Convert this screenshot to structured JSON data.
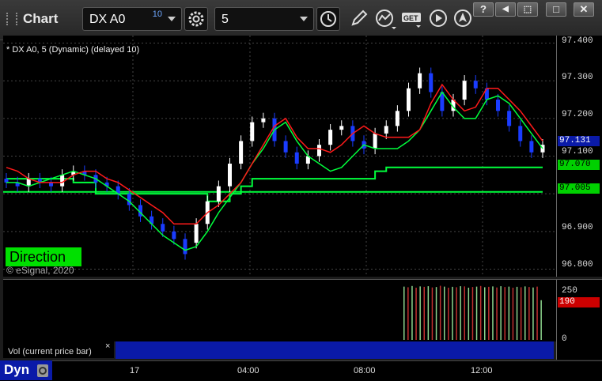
{
  "toolbar": {
    "title": "Chart",
    "symbol": "DX A0",
    "symbol_badge": "10",
    "interval": "5",
    "icons": [
      "settings-icon",
      "clock-icon",
      "pencil-icon",
      "study-icon",
      "get-icon",
      "play-icon",
      "cursor-icon"
    ]
  },
  "window_buttons": [
    "?",
    "◀",
    "⬚",
    "□",
    "✕"
  ],
  "chart": {
    "symbol_label": "* DX A0, 5 (Dynamic) (delayed 10)",
    "direction_label": "Direction",
    "copyright": "© eSignal, 2020",
    "price_labels": [
      "97.400",
      "97.300",
      "97.200",
      "97.100",
      "97.000",
      "96.900",
      "96.800"
    ],
    "price_tags": {
      "last": {
        "text": "97.131",
        "color": "#0a1aa8",
        "fg": "#ffffff"
      },
      "upper": {
        "text": "97.070",
        "color": "#00d000",
        "fg": "#000000"
      },
      "lower": {
        "text": "97.005",
        "color": "#00d000",
        "fg": "#000000"
      }
    },
    "colors": {
      "up": "#ffffff",
      "down": "#1a3cff",
      "red_line": "#ff1a1a",
      "green_line": "#00ff3c"
    }
  },
  "volume": {
    "label": "Vol (current price bar)",
    "close_symbol": "×",
    "scale_labels": [
      "250",
      "0"
    ],
    "current": {
      "text": "190",
      "color": "#cc0000"
    }
  },
  "time_axis": {
    "labels": [
      "17",
      "04:00",
      "08:00",
      "12:00"
    ],
    "corner": "Dyn"
  },
  "chart_data": {
    "type": "candlestick",
    "ylim": [
      96.78,
      97.42
    ],
    "red_trend": [
      97.07,
      97.06,
      97.04,
      97.03,
      97.03,
      97.03,
      97.05,
      97.06,
      97.06,
      97.04,
      97.03,
      97.01,
      96.99,
      96.97,
      96.95,
      96.92,
      96.92,
      96.92,
      96.95,
      96.97,
      97.0,
      97.03,
      97.08,
      97.13,
      97.18,
      97.2,
      97.15,
      97.12,
      97.12,
      97.11,
      97.13,
      97.16,
      97.18,
      97.16,
      97.15,
      97.15,
      97.15,
      97.17,
      97.24,
      97.29,
      97.25,
      97.22,
      97.23,
      97.28,
      97.28,
      97.25,
      97.22,
      97.18,
      97.14
    ],
    "green_trend": [
      97.03,
      97.03,
      97.02,
      97.03,
      97.04,
      97.05,
      97.06,
      97.05,
      97.04,
      97.02,
      97.0,
      96.98,
      96.95,
      96.92,
      96.89,
      96.87,
      96.85,
      96.86,
      96.9,
      96.95,
      96.99,
      97.03,
      97.08,
      97.12,
      97.17,
      97.19,
      97.14,
      97.1,
      97.08,
      97.06,
      97.07,
      97.1,
      97.13,
      97.12,
      97.12,
      97.12,
      97.14,
      97.17,
      97.22,
      97.27,
      97.23,
      97.2,
      97.2,
      97.25,
      97.26,
      97.24,
      97.2,
      97.16,
      97.12
    ],
    "upper_level": [
      97.04,
      97.04,
      97.04,
      97.04,
      97.04,
      97.04,
      97.03,
      97.03,
      97.0,
      97.0,
      97.0,
      97.0,
      97.0,
      97.0,
      97.0,
      97.0,
      97.0,
      97.0,
      96.98,
      96.98,
      97.0,
      97.02,
      97.04,
      97.04,
      97.04,
      97.04,
      97.04,
      97.04,
      97.04,
      97.04,
      97.04,
      97.04,
      97.04,
      97.06,
      97.07,
      97.07,
      97.07,
      97.07,
      97.07,
      97.07,
      97.07,
      97.07,
      97.07,
      97.07,
      97.07,
      97.07,
      97.07,
      97.07,
      97.07
    ],
    "lower_level": 97.005,
    "candles_open": [
      97.04,
      97.03,
      97.02,
      97.04,
      97.03,
      97.02,
      97.05,
      97.06,
      97.05,
      97.03,
      97.02,
      97.0,
      96.97,
      96.94,
      96.92,
      96.9,
      96.88,
      96.87,
      96.92,
      96.98,
      97.02,
      97.08,
      97.14,
      97.19,
      97.2,
      97.14,
      97.11,
      97.08,
      97.1,
      97.13,
      97.17,
      97.18,
      97.14,
      97.12,
      97.16,
      97.18,
      97.22,
      97.28,
      97.32,
      97.27,
      97.22,
      97.25,
      97.3,
      97.28,
      97.25,
      97.22,
      97.18,
      97.14,
      97.11
    ],
    "candles_close": [
      97.03,
      97.02,
      97.04,
      97.03,
      97.02,
      97.05,
      97.06,
      97.05,
      97.03,
      97.02,
      97.0,
      96.97,
      96.94,
      96.92,
      96.9,
      96.88,
      96.84,
      96.92,
      96.98,
      97.02,
      97.08,
      97.14,
      97.19,
      97.2,
      97.14,
      97.11,
      97.08,
      97.1,
      97.13,
      97.17,
      97.18,
      97.14,
      97.12,
      97.16,
      97.18,
      97.22,
      97.28,
      97.32,
      97.27,
      97.22,
      97.25,
      97.3,
      97.28,
      97.25,
      97.22,
      97.18,
      97.14,
      97.11,
      97.13
    ],
    "volume_values": [
      255,
      252,
      258,
      250,
      256,
      254,
      257,
      251,
      253,
      259,
      255,
      250,
      254,
      252,
      257,
      256,
      250,
      253,
      255,
      258,
      252,
      254,
      256,
      251,
      257,
      253,
      255,
      250,
      254,
      252,
      256,
      253,
      251,
      255,
      190
    ]
  }
}
